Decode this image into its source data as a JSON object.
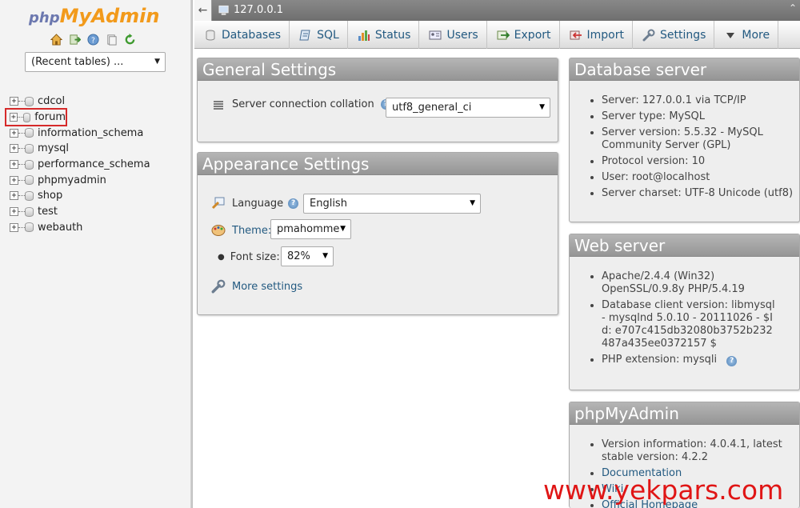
{
  "logo": {
    "php": "php",
    "myadmin": "MyAdmin"
  },
  "quick_icons": [
    "home-icon",
    "exit-icon",
    "help-icon",
    "docs-icon",
    "reload-icon"
  ],
  "recent_tables": "(Recent tables) ...",
  "databases": [
    "cdcol",
    "forum",
    "information_schema",
    "mysql",
    "performance_schema",
    "phpmyadmin",
    "shop",
    "test",
    "webauth"
  ],
  "topbar": {
    "back": "←",
    "server": "127.0.0.1",
    "collapse": "⌃"
  },
  "tabs": [
    {
      "label": "Databases",
      "icon": "database-icon"
    },
    {
      "label": "SQL",
      "icon": "sql-icon"
    },
    {
      "label": "Status",
      "icon": "status-icon"
    },
    {
      "label": "Users",
      "icon": "users-icon"
    },
    {
      "label": "Export",
      "icon": "export-icon"
    },
    {
      "label": "Import",
      "icon": "import-icon"
    },
    {
      "label": "Settings",
      "icon": "settings-icon"
    },
    {
      "label": "More",
      "icon": "more-icon"
    }
  ],
  "general": {
    "title": "General Settings",
    "collation_label": "Server connection collation",
    "colon": ":",
    "collation_value": "utf8_general_ci"
  },
  "appearance": {
    "title": "Appearance Settings",
    "language_label": "Language",
    "colon": ":",
    "language_value": "English",
    "theme_label": "Theme:",
    "theme_value": "pmahomme",
    "fontsize_label": "Font size:",
    "fontsize_value": "82%",
    "more_settings": "More settings"
  },
  "db_server": {
    "title": "Database server",
    "items": [
      "Server: 127.0.0.1 via TCP/IP",
      "Server type: MySQL",
      "Server version: 5.5.32 - MySQL Community Server (GPL)",
      "Protocol version: 10",
      "User: root@localhost",
      "Server charset: UTF-8 Unicode (utf8)"
    ]
  },
  "web_server": {
    "title": "Web server",
    "items": [
      "Apache/2.4.4 (Win32) OpenSSL/0.9.8y PHP/5.4.19",
      "Database client version: libmysql - mysqlnd 5.0.10 - 20111026 - $Id: e707c415db32080b3752b232487a435ee0372157 $",
      "PHP extension: mysqli"
    ]
  },
  "pma": {
    "title": "phpMyAdmin",
    "version": "Version information: 4.0.4.1, latest stable version: 4.2.2",
    "links": [
      "Documentation",
      "Wiki",
      "Official Homepage"
    ]
  },
  "watermark": "www.yekpars.com"
}
